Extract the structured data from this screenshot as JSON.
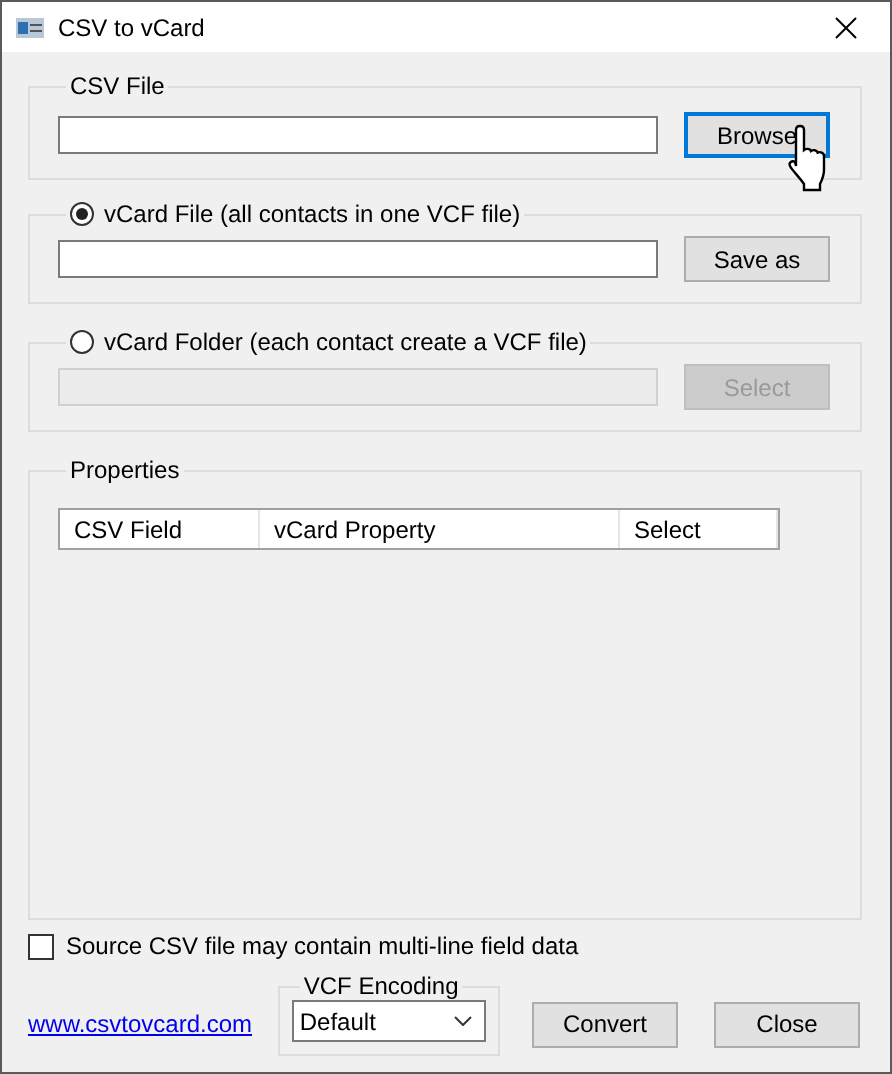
{
  "window": {
    "title": "CSV to vCard"
  },
  "csv_file": {
    "label": "CSV File",
    "button": {
      "label": "Browse",
      "focused": true
    }
  },
  "output_options": [
    {
      "label": "vCard File (all contacts in one VCF file)",
      "selected": true,
      "button": "Save as",
      "disabled": false
    },
    {
      "label": "vCard Folder (each contact create a VCF file)",
      "selected": false,
      "button": "Select",
      "disabled": true
    }
  ],
  "properties": {
    "label": "Properties",
    "columns": [
      "CSV Field",
      "vCard Property",
      "Select"
    ]
  },
  "multiline": {
    "label": "Source CSV file may contain multi-line field data",
    "checked": false
  },
  "link": "www.csvtovcard.com",
  "encoding": {
    "label": "VCF Encoding",
    "value": "Default"
  },
  "buttons": [
    "Convert",
    "Close"
  ]
}
